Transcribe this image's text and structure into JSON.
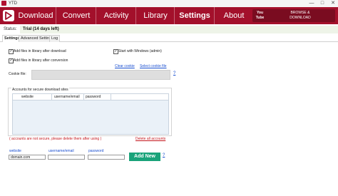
{
  "window": {
    "title": "YTD",
    "minimize": "—",
    "maximize": "□",
    "close": "✕"
  },
  "nav": {
    "tabs": [
      "Download",
      "Convert",
      "Activity",
      "Library",
      "Settings",
      "About"
    ],
    "active": "Settings",
    "badge_line1": "BROWSE &",
    "badge_line2": "DOWNLOAD",
    "badge_logo": "You Tube"
  },
  "status": {
    "label": "Status:",
    "value": "Trial (14 days left)"
  },
  "subtabs": [
    "Settings",
    "Advanced Settings",
    "Log"
  ],
  "options": {
    "add_after_download": "Add files in library after download",
    "add_after_conversion": "Add files in library after conversion",
    "start_with_windows": "Start with Windows (admin)"
  },
  "cookie": {
    "clear": "Clear cookie",
    "select": "Select cookie file",
    "label": "Cookie file:",
    "help": "?"
  },
  "accounts": {
    "legend": "Accounts for secure download sites",
    "columns": [
      "website",
      "username/email",
      "password"
    ],
    "warning": "( accounts are not secure, please delete them after using )",
    "delete_all": "Delete all accounts"
  },
  "form": {
    "website_label": "website",
    "username_label": "username/email",
    "password_label": "password",
    "website_value": "domain.com",
    "username_value": "",
    "password_value": "",
    "add_button": "Add New",
    "help": "?"
  },
  "colors": {
    "nav_bg": "#a3102b",
    "add_button": "#1aa37a",
    "link": "#1a4fd0",
    "warning": "#c4161c"
  }
}
